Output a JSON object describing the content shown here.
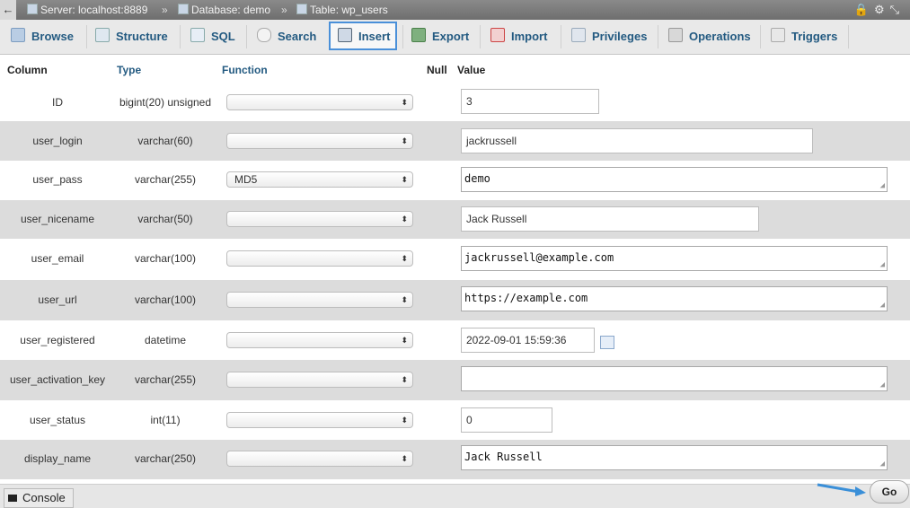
{
  "breadcrumb": {
    "back": "←",
    "server": "Server: localhost:8889",
    "database": "Database: demo",
    "table": "Table: wp_users",
    "separator": "»"
  },
  "tabs": [
    {
      "label": "Browse"
    },
    {
      "label": "Structure"
    },
    {
      "label": "SQL"
    },
    {
      "label": "Search"
    },
    {
      "label": "Insert",
      "active": true
    },
    {
      "label": "Export"
    },
    {
      "label": "Import"
    },
    {
      "label": "Privileges"
    },
    {
      "label": "Operations"
    },
    {
      "label": "Triggers"
    }
  ],
  "headers": {
    "column": "Column",
    "type": "Type",
    "function": "Function",
    "null": "Null",
    "value": "Value"
  },
  "rows": [
    {
      "column": "ID",
      "type": "bigint(20) unsigned",
      "function": "",
      "value": "3"
    },
    {
      "column": "user_login",
      "type": "varchar(60)",
      "function": "",
      "value": "jackrussell"
    },
    {
      "column": "user_pass",
      "type": "varchar(255)",
      "function": "MD5",
      "value": "demo"
    },
    {
      "column": "user_nicename",
      "type": "varchar(50)",
      "function": "",
      "value": "Jack Russell"
    },
    {
      "column": "user_email",
      "type": "varchar(100)",
      "function": "",
      "value": "jackrussell@example.com"
    },
    {
      "column": "user_url",
      "type": "varchar(100)",
      "function": "",
      "value": "https://example.com"
    },
    {
      "column": "user_registered",
      "type": "datetime",
      "function": "",
      "value": "2022-09-01 15:59:36"
    },
    {
      "column": "user_activation_key",
      "type": "varchar(255)",
      "function": "",
      "value": ""
    },
    {
      "column": "user_status",
      "type": "int(11)",
      "function": "",
      "value": "0"
    },
    {
      "column": "display_name",
      "type": "varchar(250)",
      "function": "",
      "value": "Jack Russell"
    }
  ],
  "footer": {
    "console_label": "Console",
    "go_label": "Go"
  },
  "colors": {
    "tab_text": "#235a81",
    "header_blue": "#235a81",
    "active_border": "#4a90d9",
    "arrow": "#3a8fd8"
  },
  "icons": {
    "select_arrow": "⬍",
    "resize_grip": "◢"
  }
}
